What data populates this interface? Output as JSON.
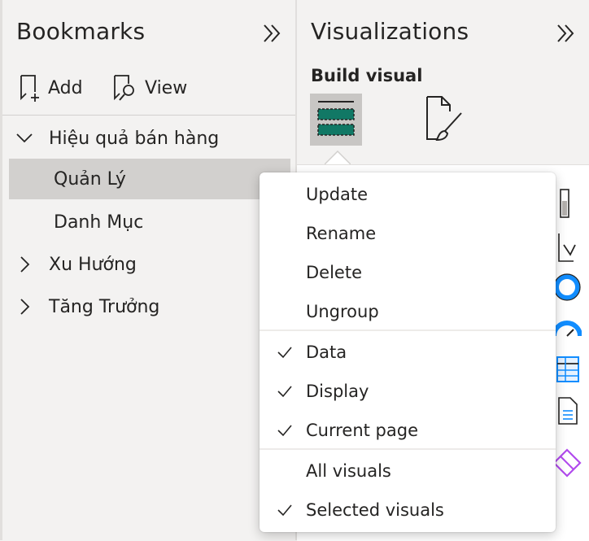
{
  "bookmarks": {
    "title": "Bookmarks",
    "toolbar": {
      "add_label": "Add",
      "view_label": "View"
    },
    "tree": [
      {
        "label": "Hiệu quả bán hàng",
        "expanded": true,
        "children": [
          {
            "label": "Quản Lý",
            "selected": true
          },
          {
            "label": "Danh Mục",
            "selected": false
          }
        ]
      },
      {
        "label": "Xu Hướng",
        "expanded": false
      },
      {
        "label": "Tăng Trưởng",
        "expanded": false
      }
    ]
  },
  "visualizations": {
    "title": "Visualizations",
    "build_label": "Build visual"
  },
  "context_menu": {
    "group1": [
      {
        "label": "Update"
      },
      {
        "label": "Rename"
      },
      {
        "label": "Delete"
      },
      {
        "label": "Ungroup"
      }
    ],
    "group2": [
      {
        "label": "Data",
        "checked": true
      },
      {
        "label": "Display",
        "checked": true
      },
      {
        "label": "Current page",
        "checked": true
      }
    ],
    "group3": [
      {
        "label": "All visuals",
        "checked": false
      },
      {
        "label": "Selected visuals",
        "checked": true
      }
    ]
  },
  "colors": {
    "accent": "#117865",
    "selection": "#d2d0ce",
    "icon_blue": "#118dff",
    "icon_purple": "#b14aed"
  }
}
